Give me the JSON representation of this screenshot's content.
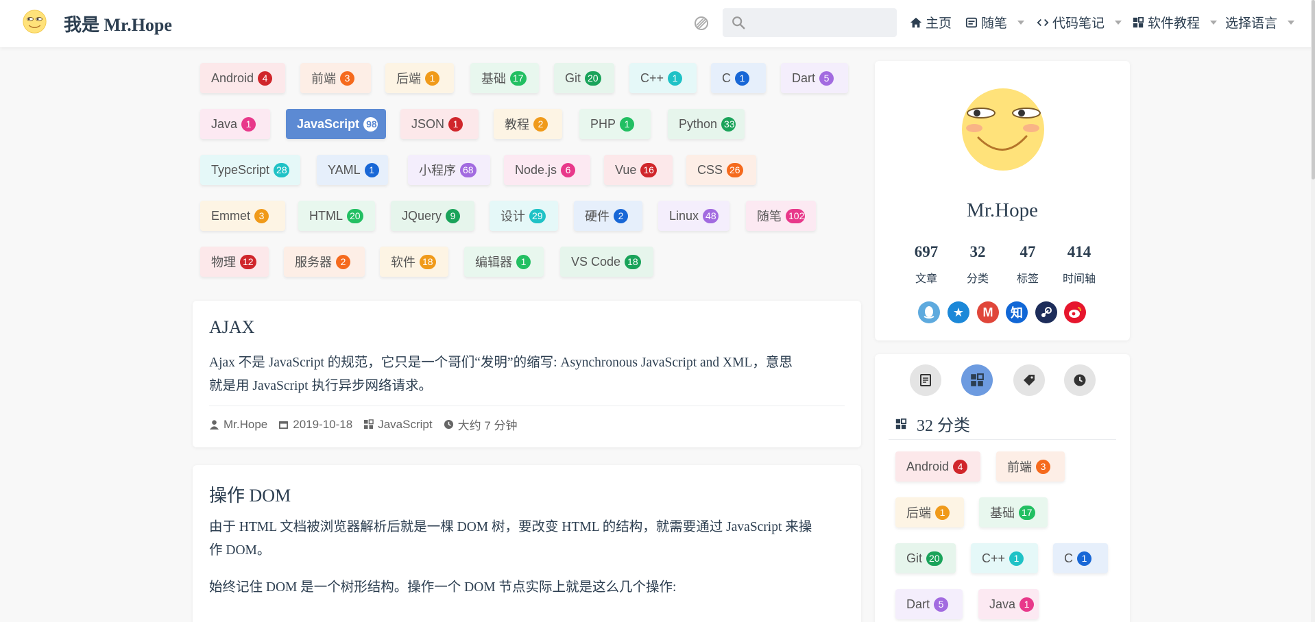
{
  "navbar": {
    "title": "我是 Mr.Hope",
    "search_placeholder": "",
    "items": [
      {
        "label": "主页",
        "has_caret": false
      },
      {
        "label": "随笔",
        "has_caret": true
      },
      {
        "label": "代码笔记",
        "has_caret": true
      },
      {
        "label": "软件教程",
        "has_caret": true
      },
      {
        "label": "选择语言",
        "has_caret": true
      }
    ]
  },
  "colors": {
    "red": "#d0262b",
    "orange": "#f56a1d",
    "amber": "#f09a1a",
    "green": "#22bf62",
    "darkgreen": "#1aa35a",
    "teal": "#1fc2c6",
    "blue": "#1867d6",
    "purple": "#a26be0",
    "pink": "#e8388a",
    "accent": "#5c8ad3"
  },
  "tags": [
    {
      "label": "Android",
      "count": "4",
      "color": "red",
      "bg": "#fce8ea"
    },
    {
      "label": "前端",
      "count": "3",
      "color": "orange",
      "bg": "#fdeee6"
    },
    {
      "label": "后端",
      "count": "1",
      "color": "amber",
      "bg": "#fdf4e4"
    },
    {
      "label": "基础",
      "count": "17",
      "color": "green",
      "bg": "#e8f7ee"
    },
    {
      "label": "Git",
      "count": "20",
      "color": "darkgreen",
      "bg": "#e6f5ec"
    },
    {
      "label": "C++",
      "count": "1",
      "color": "teal",
      "bg": "#e5f8f8"
    },
    {
      "label": "C",
      "count": "1",
      "color": "blue",
      "bg": "#e6effb"
    },
    {
      "label": "Dart",
      "count": "5",
      "color": "purple",
      "bg": "#f4eefc"
    },
    {
      "label": "Java",
      "count": "1",
      "color": "pink",
      "bg": "#fce9f2"
    },
    {
      "label": "JavaScript",
      "count": "98",
      "color": "accent",
      "bg": "#5c8ad3",
      "active": true
    },
    {
      "label": "JSON",
      "count": "1",
      "color": "red",
      "bg": "#fce8ea"
    },
    {
      "label": "教程",
      "count": "2",
      "color": "amber",
      "bg": "#fdf4e4"
    },
    {
      "label": "PHP",
      "count": "1",
      "color": "green",
      "bg": "#e8f7ee"
    },
    {
      "label": "Python",
      "count": "33",
      "color": "darkgreen",
      "bg": "#e6f5ec"
    },
    {
      "label": "TypeScript",
      "count": "28",
      "color": "teal",
      "bg": "#e5f8f8"
    },
    {
      "label": "YAML",
      "count": "1",
      "color": "blue",
      "bg": "#e6effb"
    },
    {
      "label": "小程序",
      "count": "68",
      "color": "purple",
      "bg": "#f4eefc"
    },
    {
      "label": "Node.js",
      "count": "6",
      "color": "pink",
      "bg": "#fce9f2"
    },
    {
      "label": "Vue",
      "count": "16",
      "color": "red",
      "bg": "#fce8ea"
    },
    {
      "label": "CSS",
      "count": "26",
      "color": "orange",
      "bg": "#fdeee6"
    },
    {
      "label": "Emmet",
      "count": "3",
      "color": "amber",
      "bg": "#fdf4e4"
    },
    {
      "label": "HTML",
      "count": "20",
      "color": "green",
      "bg": "#e8f7ee"
    },
    {
      "label": "JQuery",
      "count": "9",
      "color": "darkgreen",
      "bg": "#e6f5ec"
    },
    {
      "label": "设计",
      "count": "29",
      "color": "teal",
      "bg": "#e5f8f8"
    },
    {
      "label": "硬件",
      "count": "2",
      "color": "blue",
      "bg": "#e6effb"
    },
    {
      "label": "Linux",
      "count": "48",
      "color": "purple",
      "bg": "#f4eefc"
    },
    {
      "label": "随笔",
      "count": "102",
      "color": "pink",
      "bg": "#fce9f2"
    },
    {
      "label": "物理",
      "count": "12",
      "color": "red",
      "bg": "#fce8ea"
    },
    {
      "label": "服务器",
      "count": "2",
      "color": "orange",
      "bg": "#fdeee6"
    },
    {
      "label": "软件",
      "count": "18",
      "color": "amber",
      "bg": "#fdf4e4"
    },
    {
      "label": "编辑器",
      "count": "1",
      "color": "green",
      "bg": "#e8f7ee"
    },
    {
      "label": "VS Code",
      "count": "18",
      "color": "darkgreen",
      "bg": "#e6f5ec"
    }
  ],
  "articles": [
    {
      "title": "AJAX",
      "excerpt_line1": "Ajax 不是 JavaScript 的规范，它只是一个哥们“发明”的缩写: Asynchronous JavaScript and XML，意思",
      "excerpt_line2": "就是用 JavaScript 执行异步网络请求。",
      "author": "Mr.Hope",
      "date": "2019-10-18",
      "category": "JavaScript",
      "reading_time": "大约 7 分钟"
    },
    {
      "title": "操作 DOM",
      "excerpt_line1": "由于 HTML 文档被浏览器解析后就是一棵 DOM 树，要改变 HTML 的结构，就需要通过 JavaScript 来操",
      "excerpt_line2": "作 DOM。",
      "excerpt_line3": "始终记住 DOM 是一个树形结构。操作一个 DOM 节点实际上就是这么几个操作:"
    }
  ],
  "profile": {
    "name": "Mr.Hope",
    "stats": [
      {
        "num": "697",
        "label": "文章"
      },
      {
        "num": "32",
        "label": "分类"
      },
      {
        "num": "47",
        "label": "标签"
      },
      {
        "num": "414",
        "label": "时间轴"
      }
    ],
    "social": [
      {
        "icon": "qq-icon",
        "color": "#5eaade",
        "glyph": ""
      },
      {
        "icon": "qzone-icon",
        "color": "#1c88d8",
        "glyph": "★"
      },
      {
        "icon": "gmail-icon",
        "color": "#e0463a",
        "glyph": "M"
      },
      {
        "icon": "zhihu-icon",
        "color": "#1167d6",
        "glyph": "知"
      },
      {
        "icon": "steam-icon",
        "color": "#1d2d5a",
        "glyph": ""
      },
      {
        "icon": "weibo-icon",
        "color": "#e6162d",
        "glyph": ""
      }
    ]
  },
  "sidebar": {
    "heading_count": "32",
    "heading_label": "分类",
    "categories": [
      {
        "label": "Android",
        "count": "4",
        "color": "red",
        "bg": "#fce8ea"
      },
      {
        "label": "前端",
        "count": "3",
        "color": "orange",
        "bg": "#fdeee6"
      },
      {
        "label": "后端",
        "count": "1",
        "color": "amber",
        "bg": "#fdf4e4"
      },
      {
        "label": "基础",
        "count": "17",
        "color": "green",
        "bg": "#e8f7ee"
      },
      {
        "label": "Git",
        "count": "20",
        "color": "darkgreen",
        "bg": "#e6f5ec"
      },
      {
        "label": "C++",
        "count": "1",
        "color": "teal",
        "bg": "#e5f8f8"
      },
      {
        "label": "C",
        "count": "1",
        "color": "blue",
        "bg": "#e6effb"
      },
      {
        "label": "Dart",
        "count": "5",
        "color": "purple",
        "bg": "#f4eefc"
      },
      {
        "label": "Java",
        "count": "1",
        "color": "pink",
        "bg": "#fce9f2"
      }
    ]
  }
}
